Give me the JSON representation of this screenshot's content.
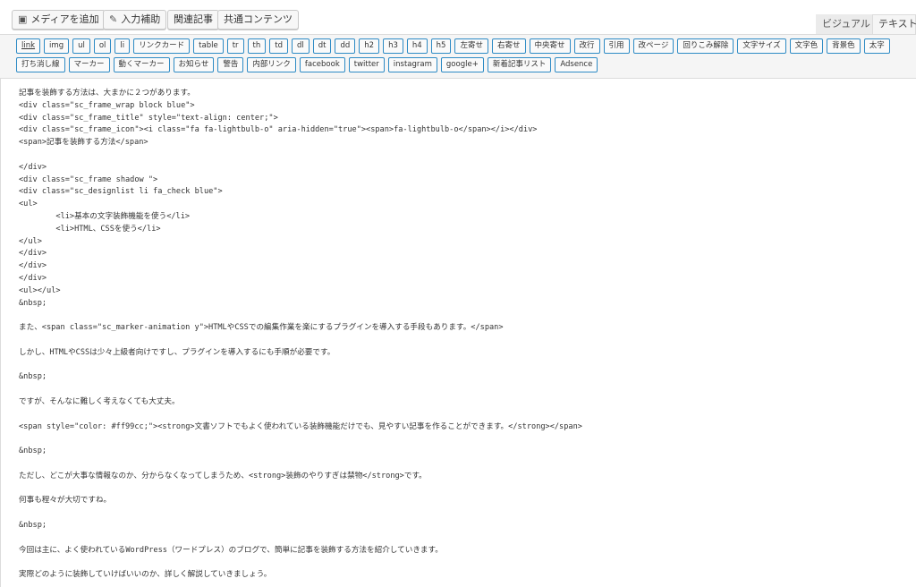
{
  "media_buttons": {
    "add_media": "メディアを追加",
    "input_assist": "入力補助",
    "related_posts": "関連記事",
    "common_content": "共通コンテンツ"
  },
  "tabs": {
    "visual": "ビジュアル",
    "text": "テキスト"
  },
  "quicktags": {
    "row1": [
      "link",
      "img",
      "ul",
      "ol",
      "li",
      "リンクカード",
      "table",
      "tr",
      "th",
      "td",
      "dl",
      "dt",
      "dd",
      "h2",
      "h3",
      "h4",
      "h5",
      "左寄せ",
      "右寄せ",
      "中央寄せ",
      "改行",
      "引用",
      "改ページ",
      "回りこみ解除",
      "文字サイズ",
      "文字色",
      "背景色",
      "太字"
    ],
    "row2": [
      "打ち消し線",
      "マーカー",
      "動くマーカー",
      "お知らせ",
      "警告",
      "内部リンク",
      "facebook",
      "twitter",
      "instagram",
      "google+",
      "新着記事リスト",
      "Adsence"
    ]
  },
  "editor_lines": [
    "記事を装飾する方法は、大まかに２つがあります。",
    "<div class=\"sc_frame_wrap block blue\">",
    "<div class=\"sc_frame_title\" style=\"text-align: center;\">",
    "<div class=\"sc_frame_icon\"><i class=\"fa fa-lightbulb-o\" aria-hidden=\"true\"><span>fa-lightbulb-o</span></i></div>",
    "<span>記事を装飾する方法</span>",
    "",
    "</div>",
    "<div class=\"sc_frame shadow \">",
    "<div class=\"sc_designlist li fa_check blue\">",
    "<ul>",
    "        <li>基本の文字装飾機能を使う</li>",
    "        <li>HTML、CSSを使う</li>",
    "</ul>",
    "</div>",
    "</div>",
    "</div>",
    "<ul></ul>",
    "&nbsp;",
    "",
    "また、<span class=\"sc_marker-animation y\">HTMLやCSSでの編集作業を楽にするプラグインを導入する手段もあります。</span>",
    "",
    "しかし、HTMLやCSSは少々上級者向けですし、プラグインを導入するにも手順が必要です。",
    "",
    "&nbsp;",
    "",
    "ですが、そんなに難しく考えなくても大丈夫。",
    "",
    "<span style=\"color: #ff99cc;\"><strong>文書ソフトでもよく使われている装飾機能だけでも、見やすい記事を作ることができます。</strong></span>",
    "",
    "&nbsp;",
    "",
    "ただし、どこが大事な情報なのか、分からなくなってしまうため、<strong>装飾のやりすぎは禁物</strong>です。",
    "",
    "何事も程々が大切ですね。",
    "",
    "&nbsp;",
    "",
    "今回は主に、よく使われているWordPress（ワードプレス）のブログで、簡単に記事を装飾する方法を紹介していきます。",
    "",
    "実際どのように装飾していけばいいのか、詳しく解説していきましょう。"
  ]
}
